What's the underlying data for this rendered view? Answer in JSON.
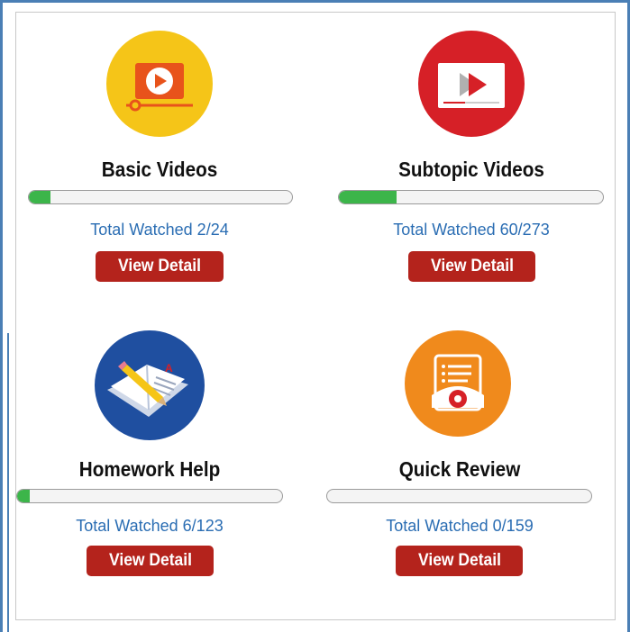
{
  "cards": [
    {
      "title": "Basic Videos",
      "watched_text": "Total Watched 2/24",
      "progress": 0.083,
      "button": "View Detail",
      "icon": "play-video-icon",
      "icon_color": "#f5c518"
    },
    {
      "title": "Subtopic Videos",
      "watched_text": "Total Watched 60/273",
      "progress": 0.22,
      "button": "View Detail",
      "icon": "video-player-icon",
      "icon_color": "#d62027"
    },
    {
      "title": "Homework Help",
      "watched_text": "Total Watched 6/123",
      "progress": 0.049,
      "button": "View Detail",
      "icon": "book-pencil-icon",
      "icon_color": "#1f4fa0"
    },
    {
      "title": "Quick Review",
      "watched_text": "Total Watched 0/159",
      "progress": 0.0,
      "button": "View Detail",
      "icon": "review-eye-icon",
      "icon_color": "#f08a1c"
    }
  ],
  "colors": {
    "progress_fill": "#3cb54a",
    "button_bg": "#b4231c",
    "link_text": "#2a6db3",
    "frame": "#4a7fb5"
  }
}
